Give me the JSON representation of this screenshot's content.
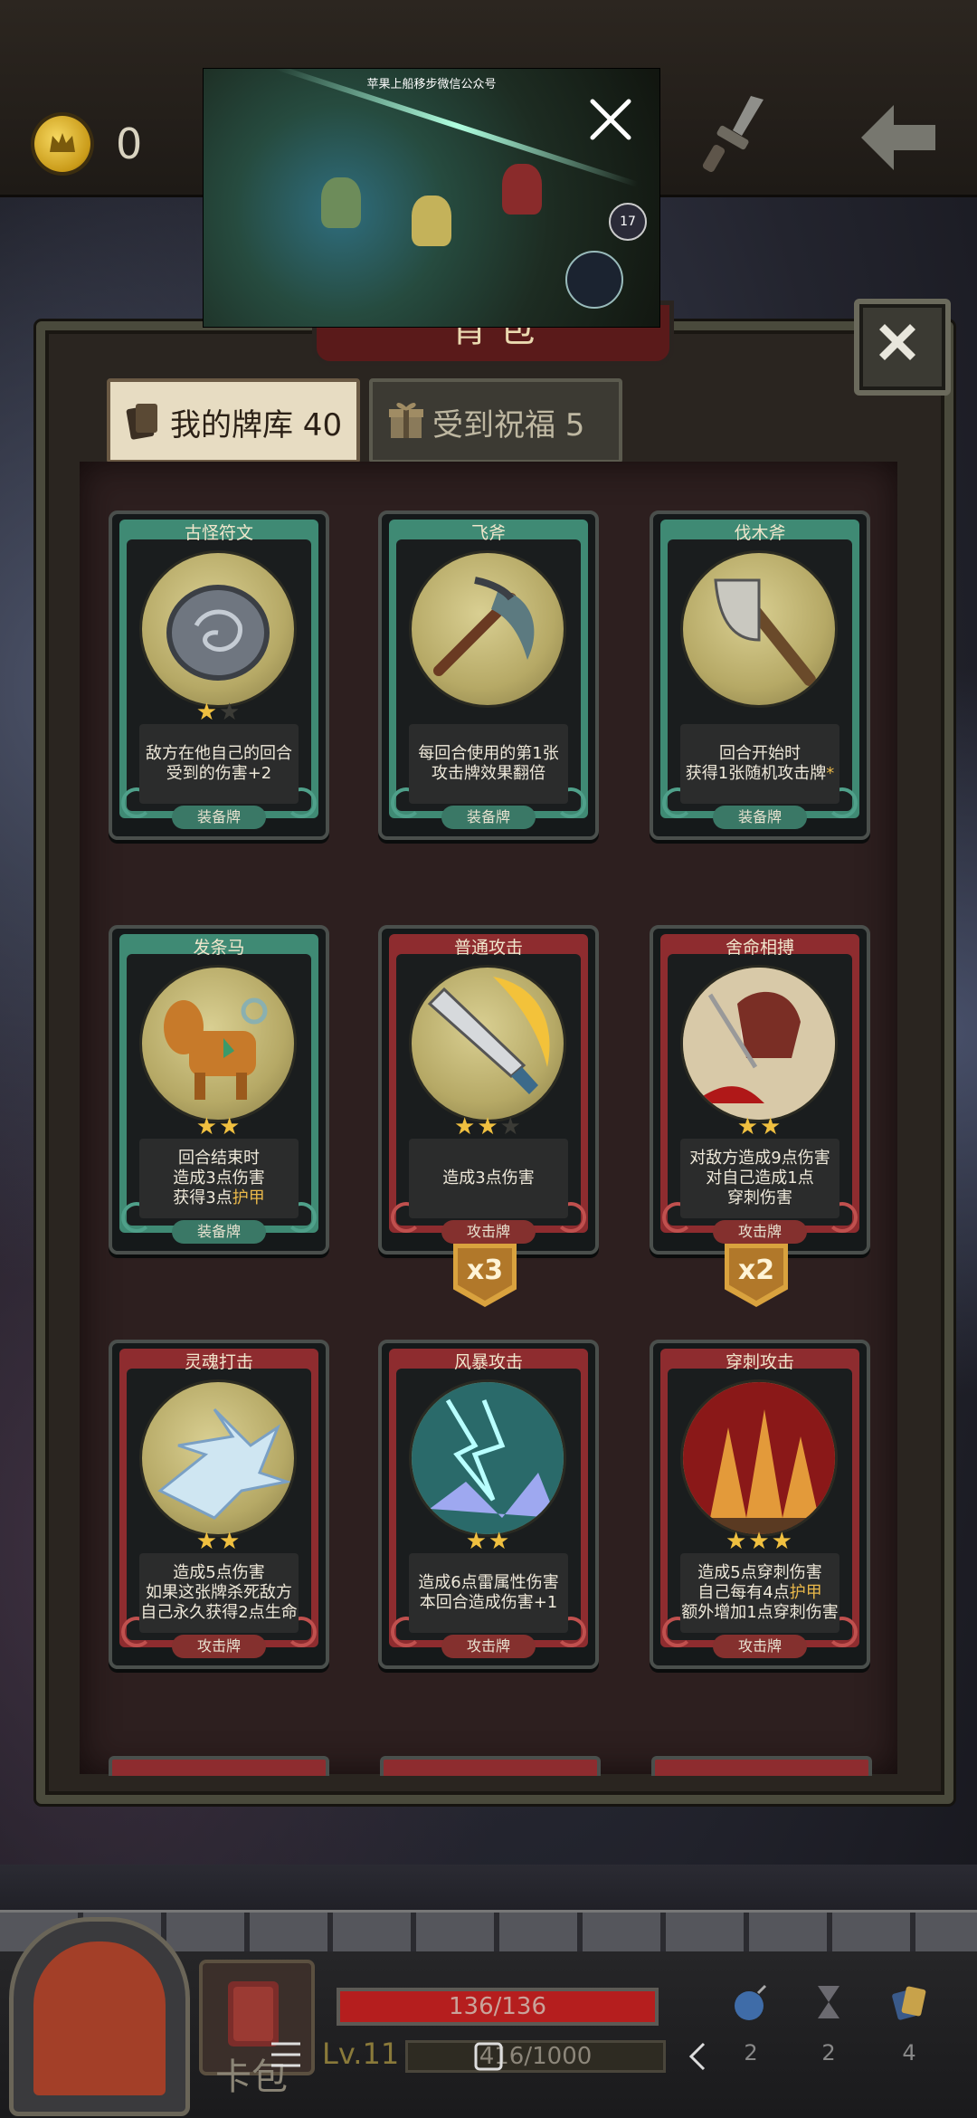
{
  "top": {
    "coins": "0"
  },
  "video": {
    "caption": "苹果上船移步微信公众号"
  },
  "panel": {
    "header": "背 包"
  },
  "tabs": [
    {
      "label": "我的牌库 40"
    },
    {
      "label": "受到祝福 5"
    }
  ],
  "cards": [
    {
      "title": "古怪符文",
      "color": "green",
      "stars": 1,
      "max_stars": 2,
      "desc": [
        "敌方在他自己的回合",
        "受到的伤害+2"
      ],
      "type": "装备牌",
      "icon": "rune-stone-icon"
    },
    {
      "title": "飞斧",
      "color": "green",
      "stars": 0,
      "max_stars": 0,
      "desc": [
        "每回合使用的第1张",
        "攻击牌效果翻倍"
      ],
      "type": "装备牌",
      "icon": "axe-icon"
    },
    {
      "title": "伐木斧",
      "color": "green",
      "stars": 0,
      "max_stars": 0,
      "desc": [
        "回合开始时",
        "获得1张随机攻击牌*"
      ],
      "type": "装备牌",
      "icon": "lumber-axe-icon"
    },
    {
      "title": "发条马",
      "color": "green",
      "stars": 2,
      "max_stars": 2,
      "desc": [
        "回合结束时",
        "造成3点伤害",
        "获得3点护甲"
      ],
      "type": "装备牌",
      "icon": "clockwork-horse-icon"
    },
    {
      "title": "普通攻击",
      "color": "red",
      "stars": 2,
      "max_stars": 3,
      "desc": [
        "造成3点伤害"
      ],
      "type": "攻击牌",
      "icon": "sword-slash-icon",
      "multiplier": "x3"
    },
    {
      "title": "舍命相搏",
      "color": "red",
      "stars": 2,
      "max_stars": 2,
      "desc": [
        "对敌方造成9点伤害",
        "对自己造成1点",
        "穿刺伤害"
      ],
      "type": "攻击牌",
      "icon": "desperate-strike-icon",
      "multiplier": "x2"
    },
    {
      "title": "灵魂打击",
      "color": "red",
      "stars": 2,
      "max_stars": 2,
      "desc": [
        "造成5点伤害",
        "如果这张牌杀死敌方",
        "自己永久获得2点生命"
      ],
      "type": "攻击牌",
      "icon": "soul-strike-icon"
    },
    {
      "title": "风暴攻击",
      "color": "red",
      "stars": 2,
      "max_stars": 2,
      "desc": [
        "造成6点雷属性伤害",
        "本回合造成伤害+1"
      ],
      "type": "攻击牌",
      "icon": "storm-strike-icon"
    },
    {
      "title": "穿刺攻击",
      "color": "red",
      "stars": 3,
      "max_stars": 3,
      "desc": [
        "造成5点穿刺伤害",
        "自己每有4点护甲",
        "额外增加1点穿刺伤害"
      ],
      "type": "攻击牌",
      "icon": "pierce-strike-icon"
    }
  ],
  "bottom": {
    "deck_label": "卡包",
    "hp_text": "136/136",
    "hp_fraction": 1.0,
    "level": "Lv.11",
    "xp_text": "416/1000",
    "items": [
      {
        "icon": "bomb-icon",
        "count": "2"
      },
      {
        "icon": "hourglass-icon",
        "count": "2"
      },
      {
        "icon": "card-stack-icon",
        "count": "4"
      }
    ]
  }
}
